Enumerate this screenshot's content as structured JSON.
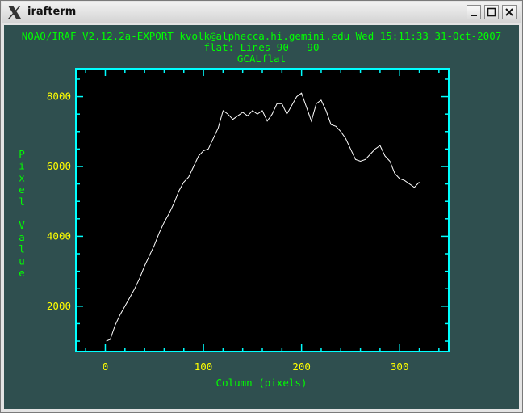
{
  "window": {
    "title": "irafterm",
    "app_icon": "x-logo-icon"
  },
  "controls": {
    "minimize_icon": "minimize-icon",
    "maximize_icon": "maximize-icon",
    "close_icon": "close-icon"
  },
  "colors": {
    "terminal_bg": "#2f4f4f",
    "plot_bg": "#000000",
    "frame": "#00ffff",
    "header_text": "#00ff00",
    "tick_labels": "#ffff00",
    "data_line": "#ffffff"
  },
  "header": {
    "line1": "NOAO/IRAF V2.12.2a-EXPORT kvolk@alphecca.hi.gemini.edu Wed 15:11:33 31-Oct-2007",
    "line2": "flat: Lines 90 - 90",
    "line3": "GCALflat"
  },
  "chart_data": {
    "type": "line",
    "title": "GCALflat",
    "subtitle": "flat: Lines 90 - 90",
    "xlabel": "Column (pixels)",
    "ylabel": "Pixel Value",
    "xlim": [
      -30,
      350
    ],
    "ylim": [
      700,
      8800
    ],
    "x_ticks": [
      0,
      100,
      200,
      300
    ],
    "y_ticks": [
      2000,
      4000,
      6000,
      8000
    ],
    "x_tick_labels": [
      "0",
      "100",
      "200",
      "300"
    ],
    "y_tick_labels": [
      "2000",
      "4000",
      "6000",
      "8000"
    ],
    "grid": false,
    "series": [
      {
        "x": [
          1,
          5,
          10,
          15,
          20,
          25,
          30,
          35,
          40,
          45,
          50,
          55,
          60,
          65,
          70,
          75,
          80,
          85,
          90,
          95,
          100,
          105,
          110,
          115,
          120,
          125,
          130,
          135,
          140,
          145,
          150,
          155,
          160,
          165,
          170,
          175,
          180,
          185,
          190,
          195,
          200,
          205,
          210,
          215,
          220,
          225,
          230,
          235,
          240,
          245,
          250,
          255,
          260,
          265,
          270,
          275,
          280,
          285,
          290,
          295,
          300,
          305,
          310,
          315,
          320
        ],
        "y": [
          1000,
          1050,
          1450,
          1750,
          2000,
          2250,
          2500,
          2800,
          3150,
          3450,
          3750,
          4100,
          4400,
          4650,
          4950,
          5300,
          5550,
          5700,
          6000,
          6300,
          6450,
          6500,
          6800,
          7100,
          7600,
          7500,
          7350,
          7450,
          7550,
          7450,
          7600,
          7500,
          7600,
          7300,
          7500,
          7800,
          7800,
          7500,
          7750,
          8000,
          8100,
          7700,
          7300,
          7800,
          7900,
          7600,
          7200,
          7150,
          7000,
          6800,
          6500,
          6200,
          6150,
          6200,
          6350,
          6500,
          6600,
          6300,
          6150,
          5800,
          5650,
          5600,
          5500,
          5400,
          5550
        ]
      }
    ]
  }
}
